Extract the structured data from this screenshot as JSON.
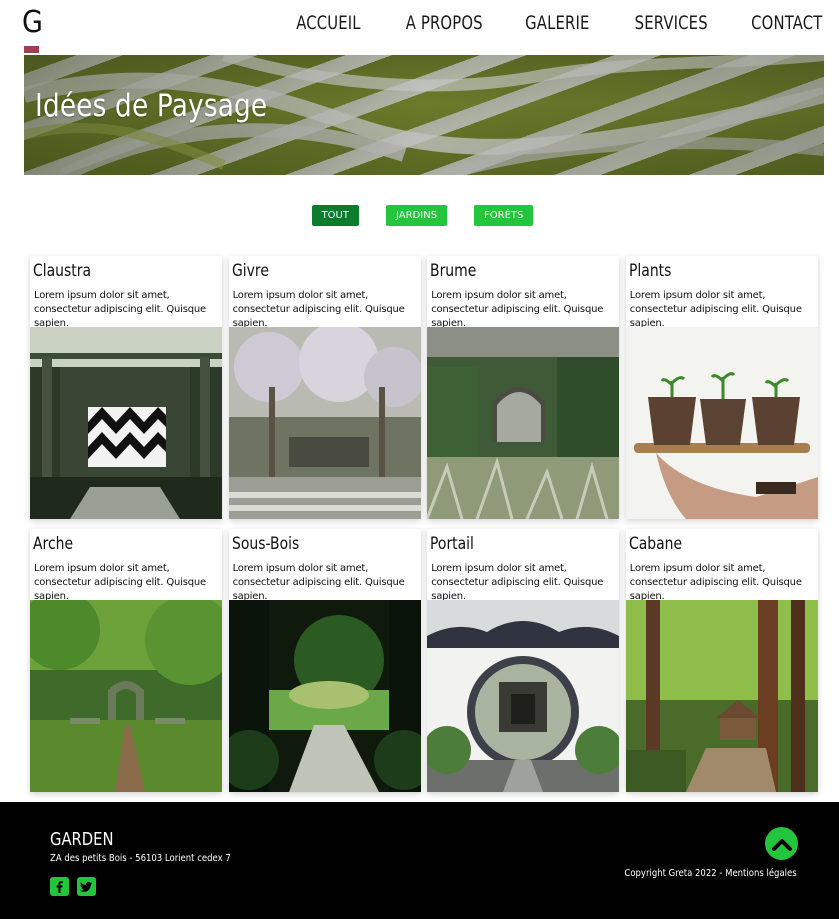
{
  "header": {
    "logo_letter": "G",
    "nav": [
      "ACCUEIL",
      "A PROPOS",
      "GALERIE",
      "SERVICES",
      "CONTACT"
    ]
  },
  "hero": {
    "title": "Idées de Paysage"
  },
  "filters": [
    {
      "label": "TOUT",
      "active": true
    },
    {
      "label": "JARDINS",
      "active": false
    },
    {
      "label": "FORÊTS",
      "active": false
    }
  ],
  "cards": [
    {
      "title": "Claustra",
      "text": "Lorem ipsum dolor sit amet, consectetur adipiscing elit. Quisque sapien.",
      "image": "claustra-photo"
    },
    {
      "title": "Givre",
      "text": "Lorem ipsum dolor sit amet, consectetur adipiscing elit. Quisque sapien.",
      "image": "givre-photo"
    },
    {
      "title": "Brume",
      "text": "Lorem ipsum dolor sit amet, consectetur adipiscing elit. Quisque sapien.",
      "image": "brume-photo"
    },
    {
      "title": "Plants",
      "text": "Lorem ipsum dolor sit amet, consectetur adipiscing elit. Quisque sapien.",
      "image": "plants-photo"
    },
    {
      "title": "Arche",
      "text": "Lorem ipsum dolor sit amet, consectetur adipiscing elit. Quisque sapien.",
      "image": "arche-photo"
    },
    {
      "title": "Sous-Bois",
      "text": "Lorem ipsum dolor sit amet, consectetur adipiscing elit. Quisque sapien.",
      "image": "sous-bois-photo"
    },
    {
      "title": "Portail",
      "text": "Lorem ipsum dolor sit amet, consectetur adipiscing elit. Quisque sapien.",
      "image": "portail-photo"
    },
    {
      "title": "Cabane",
      "text": "Lorem ipsum dolor sit amet, consectetur adipiscing elit. Quisque sapien.",
      "image": "cabane-photo"
    }
  ],
  "footer": {
    "brand": "GARDEN",
    "address": "ZA des petits Bois - 56103 Lorient cedex 7",
    "copyright": "Copyright Greta 2022 - Mentions légales",
    "social": [
      "facebook-icon",
      "twitter-icon"
    ]
  },
  "colors": {
    "accent_green": "#23c53c",
    "active_green": "#0a7c2c",
    "logo_bar": "#a0404f",
    "footer_bg": "#000000"
  }
}
